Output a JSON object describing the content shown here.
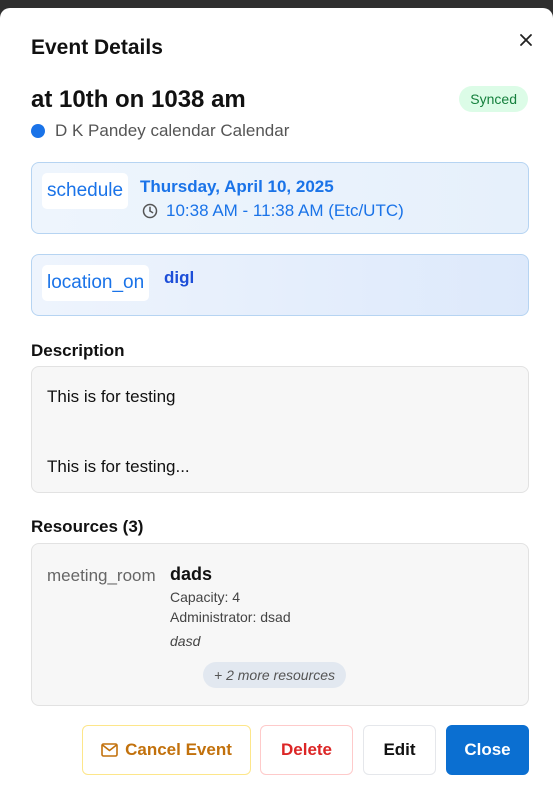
{
  "dialog": {
    "title": "Event Details"
  },
  "event": {
    "title": "at 10th on 1038 am",
    "status_badge": "Synced",
    "calendar_name": "D K Pandey calendar Calendar",
    "calendar_color": "#1a73e8"
  },
  "schedule": {
    "icon_text": "schedule",
    "date": "Thursday, April 10, 2025",
    "time_range": "10:38 AM - 11:38 AM (Etc/UTC)"
  },
  "location": {
    "icon_text": "location_on",
    "name": "digl"
  },
  "description": {
    "label": "Description",
    "line1": "This is for testing",
    "line2": "This is for testing..."
  },
  "resources": {
    "label": "Resources (3)",
    "items": [
      {
        "icon_text": "meeting_room",
        "name": "dads",
        "capacity": "Capacity: 4",
        "administrator": "Administrator: dsad",
        "note": "dasd"
      }
    ],
    "more_label": "+ 2 more resources"
  },
  "actions": {
    "cancel_event": "Cancel Event",
    "delete": "Delete",
    "edit": "Edit",
    "close": "Close"
  },
  "colors": {
    "primary": "#0b6fd1",
    "synced_bg": "#dcfce7",
    "synced_text": "#15803d",
    "cancel_text": "#c2710c",
    "delete_text": "#dc2626"
  }
}
